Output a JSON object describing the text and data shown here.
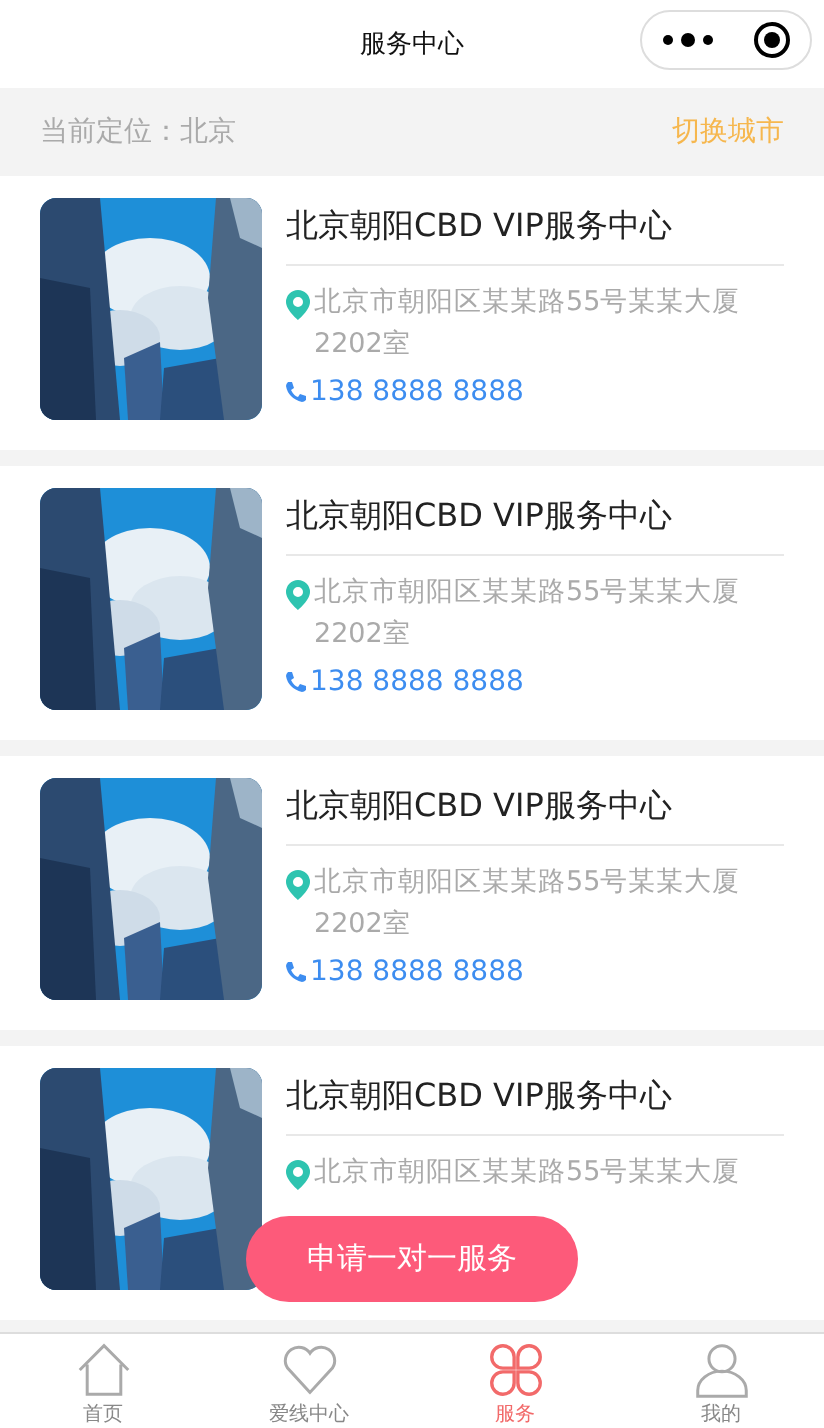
{
  "nav_bar": {
    "title": "服务中心"
  },
  "location_bar": {
    "current": "当前定位：北京",
    "switch_link": "切换城市"
  },
  "centers": [
    {
      "kind": "picture",
      "name": "北京朝阳CBD VIP服务中心",
      "address": "北京市朝阳区某某路55号某某大厦2202室",
      "phone": "138 8888 8888"
    },
    {
      "kind": "picture",
      "name": "北京朝阳CBD VIP服务中心",
      "address": "北京市朝阳区某某路55号某某大厦2202室",
      "phone": "138 8888 8888"
    },
    {
      "kind": "picture",
      "name": "北京朝阳CBD VIP服务中心",
      "address": "北京市朝阳区某某路55号某某大厦2202室",
      "phone": "138 8888 8888"
    },
    {
      "kind": "picture",
      "name": "北京朝阳CBD VIP服务中心",
      "address": "北京市朝阳区某某路55号某某大厦"
    }
  ],
  "apply_button": "申请一对一服务",
  "tab_bar": [
    {
      "kind": "home",
      "label": "首页",
      "selected": false
    },
    {
      "kind": "heart",
      "label": "爱线中心",
      "selected": false
    },
    {
      "kind": "petals",
      "label": "服务",
      "selected": true
    },
    {
      "kind": "person",
      "label": "我的",
      "selected": false
    }
  ]
}
